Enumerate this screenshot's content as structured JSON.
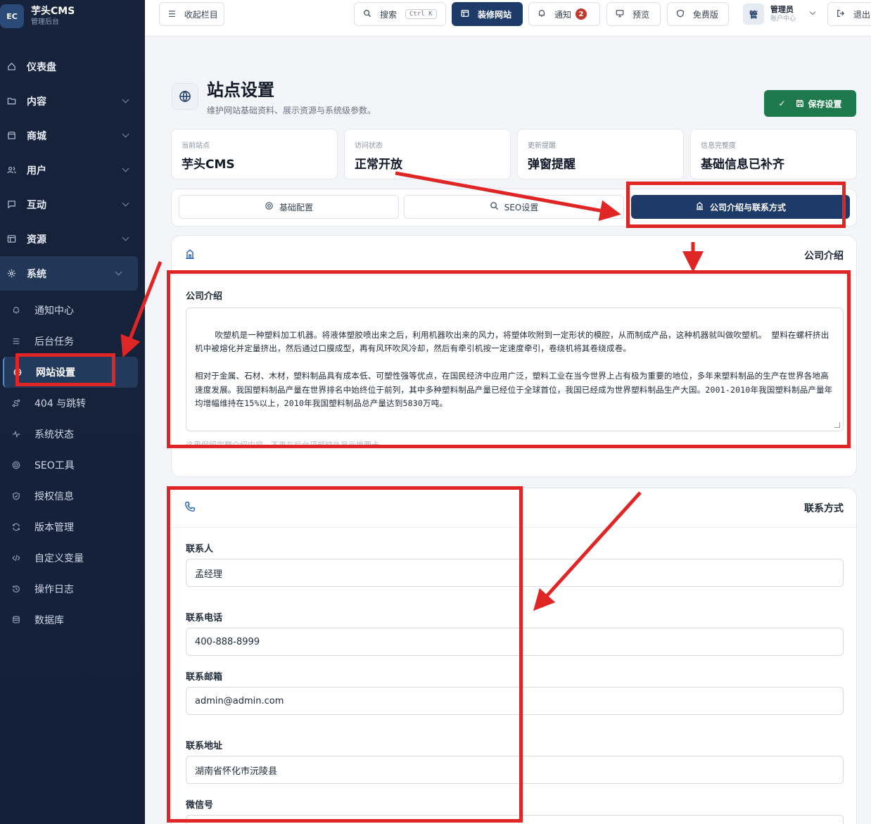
{
  "brand": {
    "logo": "EC",
    "title": "芋头CMS",
    "subtitle": "管理后台"
  },
  "nav": [
    {
      "label": "仪表盘",
      "icon": "home-icon",
      "expand": false
    },
    {
      "label": "内容",
      "icon": "folder-icon",
      "expand": true
    },
    {
      "label": "商城",
      "icon": "store-icon",
      "expand": true
    },
    {
      "label": "用户",
      "icon": "users-icon",
      "expand": true
    },
    {
      "label": "互动",
      "icon": "message-icon",
      "expand": true
    },
    {
      "label": "资源",
      "icon": "layout-icon",
      "expand": true
    },
    {
      "label": "系统",
      "icon": "gear-icon",
      "expand": true
    }
  ],
  "system_sub": [
    {
      "label": "通知中心",
      "icon": "bell-icon"
    },
    {
      "label": "后台任务",
      "icon": "list-icon"
    },
    {
      "label": "网站设置",
      "icon": "globe-icon"
    },
    {
      "label": "404 与跳转",
      "icon": "route-icon"
    },
    {
      "label": "系统状态",
      "icon": "activity-icon"
    },
    {
      "label": "SEO工具",
      "icon": "target-icon"
    },
    {
      "label": "授权信息",
      "icon": "shield-icon"
    },
    {
      "label": "版本管理",
      "icon": "refresh-icon"
    },
    {
      "label": "自定义变量",
      "icon": "code-icon"
    },
    {
      "label": "操作日志",
      "icon": "history-icon"
    },
    {
      "label": "数据库",
      "icon": "database-icon"
    }
  ],
  "topbar": {
    "collapse": "收起栏目",
    "search": "搜索",
    "search_kbd": "Ctrl K",
    "decorate": "装修网站",
    "notify": "通知",
    "notify_count": "2",
    "preview": "预览",
    "edition": "免费版",
    "user_avatar": "管",
    "user_name": "管理员",
    "user_sub": "账户中心",
    "logout": "退出"
  },
  "page": {
    "title": "站点设置",
    "subtitle": "维护网站基础资料、展示资源与系统级参数。",
    "save": "保存设置"
  },
  "stats": [
    {
      "label": "当前站点",
      "value": "芋头CMS"
    },
    {
      "label": "访问状态",
      "value": "正常开放"
    },
    {
      "label": "更新提醒",
      "value": "弹窗提醒"
    },
    {
      "label": "信息完整度",
      "value": "基础信息已补齐"
    }
  ],
  "tabs": [
    {
      "label": "基础配置",
      "icon": "gear-icon"
    },
    {
      "label": "SEO设置",
      "icon": "search-icon"
    },
    {
      "label": "公司介绍与联系方式",
      "icon": "building-icon"
    }
  ],
  "intro_card": {
    "title": "公司介绍",
    "field_label": "公司介绍",
    "text": "吹塑机是一种塑料加工机器。将液体塑胶喷出来之后，利用机器吹出来的风力，将塑体吹附到一定形状的模腔，从而制成产品，这种机器就叫做吹塑机。 塑料在螺杆挤出机中被熔化并定量挤出，然后通过口膜成型，再有风环吹风冷却，然后有牵引机按一定速度牵引，卷绕机将其卷绕成卷。\n\n相对于金属、石材、木材，塑料制品具有成本低、可塑性强等优点，在国民经济中应用广泛，塑料工业在当今世界上占有极为重要的地位，多年来塑料制品的生产在世界各地高速度发展。我国塑料制品产量在世界排名中始终位于前列，其中多种塑料制品产量已经位于全球首位，我国已经成为世界塑料制品生产大国。2001-2010年我国塑料制品产量年均增幅维持在15%以上，2010年我国塑料制品总产量达到5830万吨。",
    "hint": "这里保留完整介绍内容，不再在后台顶部额外显示摘要卡。"
  },
  "contact_card": {
    "title": "联系方式",
    "fields": [
      {
        "label": "联系人",
        "value": "孟经理"
      },
      {
        "label": "联系电话",
        "value": "400-888-8999"
      },
      {
        "label": "联系邮箱",
        "value": "admin@admin.com"
      },
      {
        "label": "联系地址",
        "value": "湖南省怀化市沅陵县"
      },
      {
        "label": "微信号",
        "value": ""
      }
    ]
  },
  "colors": {
    "sidebar": "#17233a",
    "primary": "#1e3a68",
    "save": "#1e7a4c",
    "annotation": "#e02525",
    "badge": "#c0392b"
  }
}
